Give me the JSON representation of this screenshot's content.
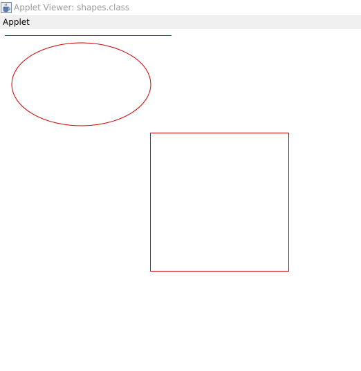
{
  "window": {
    "title": "Applet Viewer: shapes.class",
    "title_icon": "java-coffee-cup-icon"
  },
  "menubar": {
    "items": [
      {
        "label": "Applet"
      }
    ]
  },
  "applet": {
    "stroke_color": "#cc0000",
    "shapes": [
      "line",
      "ellipse",
      "rectangle"
    ]
  }
}
